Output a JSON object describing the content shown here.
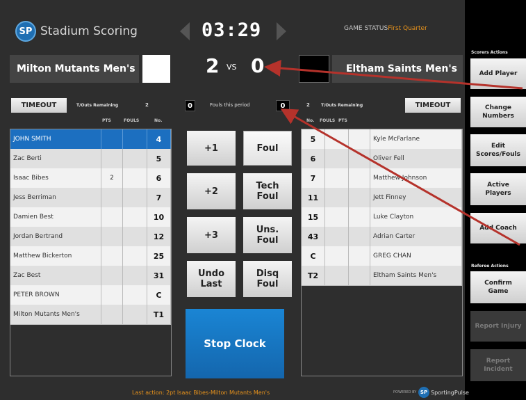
{
  "header": {
    "logo_text": "SP",
    "brand": "Stadium Scoring",
    "clock": "03:29",
    "status_label": "GAME STATUS",
    "status_value": "First Quarter"
  },
  "home": {
    "name": "Milton Mutants Men's",
    "score": "2",
    "swatch_color": "#ffffff",
    "timeout_label": "TIMEOUT",
    "touts_label": "T/Outs Remaining",
    "touts_value": "2",
    "fouls_period": "0",
    "col_pts": "PTS",
    "col_fouls": "FOULS",
    "col_no": "No.",
    "players": [
      {
        "name": "JOHN SMITH",
        "pts": "",
        "fouls": "",
        "no": "4"
      },
      {
        "name": "Zac Berti",
        "pts": "",
        "fouls": "",
        "no": "5"
      },
      {
        "name": "Isaac Bibes",
        "pts": "2",
        "fouls": "",
        "no": "6"
      },
      {
        "name": "Jess Berriman",
        "pts": "",
        "fouls": "",
        "no": "7"
      },
      {
        "name": "Damien Best",
        "pts": "",
        "fouls": "",
        "no": "10"
      },
      {
        "name": "Jordan Bertrand",
        "pts": "",
        "fouls": "",
        "no": "12"
      },
      {
        "name": "Matthew Bickerton",
        "pts": "",
        "fouls": "",
        "no": "25"
      },
      {
        "name": "Zac Best",
        "pts": "",
        "fouls": "",
        "no": "31"
      },
      {
        "name": "PETER BROWN",
        "pts": "",
        "fouls": "",
        "no": "C"
      },
      {
        "name": "Milton Mutants Men's",
        "pts": "",
        "fouls": "",
        "no": "T1"
      }
    ]
  },
  "vs_label": "VS",
  "fouls_period_label": "Fouls this period",
  "away": {
    "name": "Eltham Saints Men's",
    "score": "0",
    "swatch_color": "#000000",
    "timeout_label": "TIMEOUT",
    "touts_label": "T/Outs Remaining",
    "touts_value": "2",
    "fouls_period": "0",
    "col_no": "No.",
    "col_fouls": "FOULS",
    "col_pts": "PTS",
    "players": [
      {
        "no": "5",
        "fouls": "",
        "pts": "",
        "name": "Kyle McFarlane"
      },
      {
        "no": "6",
        "fouls": "",
        "pts": "",
        "name": "Oliver Fell"
      },
      {
        "no": "7",
        "fouls": "",
        "pts": "",
        "name": "Matthew Johnson"
      },
      {
        "no": "11",
        "fouls": "",
        "pts": "",
        "name": "Jett Finney"
      },
      {
        "no": "15",
        "fouls": "",
        "pts": "",
        "name": "Luke Clayton"
      },
      {
        "no": "43",
        "fouls": "",
        "pts": "",
        "name": "Adrian Carter"
      },
      {
        "no": "C",
        "fouls": "",
        "pts": "",
        "name": "GREG CHAN"
      },
      {
        "no": "T2",
        "fouls": "",
        "pts": "",
        "name": "Eltham Saints Men's"
      }
    ]
  },
  "actions": {
    "plus1": "+1",
    "plus2": "+2",
    "plus3": "+3",
    "undo1": "Undo",
    "undo2": "Last",
    "foul": "Foul",
    "tech1": "Tech",
    "tech2": "Foul",
    "uns1": "Uns.",
    "uns2": "Foul",
    "disq1": "Disq",
    "disq2": "Foul",
    "stop_clock": "Stop Clock"
  },
  "sidebar": {
    "scorers_header": "Scorers Actions",
    "add_player": "Add Player",
    "change1": "Change",
    "change2": "Numbers",
    "edit1": "Edit",
    "edit2": "Scores/Fouls",
    "active1": "Active",
    "active2": "Players",
    "add_coach": "Add Coach",
    "referee_header": "Referee Actions",
    "confirm1": "Confirm",
    "confirm2": "Game",
    "report_injury": "Report Injury",
    "incident1": "Report",
    "incident2": "Incident"
  },
  "footer": {
    "last_action": "Last action: 2pt Isaac Bibes-Milton Mutants Men's",
    "powered_by": "POWERED BY",
    "sp_logo": "SP",
    "sporting_pulse": "SportingPulse"
  },
  "colors": {
    "accent": "#1c6fc0",
    "status": "#e8931c",
    "annotation_arrow": "#b5322b"
  }
}
